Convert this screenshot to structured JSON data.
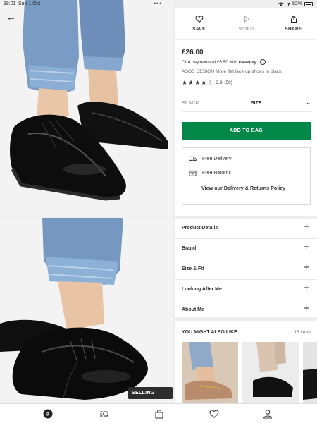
{
  "status_bar": {
    "time": "18:01",
    "date": "Sun 1 Oct",
    "battery": "82%",
    "icons": [
      "wifi-icon",
      "location-icon",
      "battery-icon"
    ]
  },
  "header": {
    "back_icon": "back-arrow-icon"
  },
  "badge": {
    "selling_fast": "SELLING FAST"
  },
  "actions": [
    {
      "label": "SAVE",
      "icon": "heart-icon"
    },
    {
      "label": "VIDEO",
      "icon": "play-icon"
    },
    {
      "label": "SHARE",
      "icon": "share-icon"
    }
  ],
  "product": {
    "price": "£26.00",
    "clearpay_text": "Or 4 payments of £6.50 with",
    "clearpay_brand": "clearpay",
    "name": "ASOS DESIGN More flat lace up shoes in black",
    "rating": "3.9",
    "reviews": "(50)",
    "stars_filled": 4
  },
  "selectors": {
    "colour": "BLACK",
    "size": "SIZE"
  },
  "add_to_bag": "ADD TO BAG",
  "delivery": {
    "free_delivery": "Free Delivery",
    "free_returns": "Free Returns",
    "policy_link": "View our Delivery & Returns Policy"
  },
  "accordion": [
    {
      "label": "Product Details"
    },
    {
      "label": "Brand"
    },
    {
      "label": "Size & Fit"
    },
    {
      "label": "Looking After Me"
    },
    {
      "label": "About Me"
    }
  ],
  "also_like": {
    "title": "YOU MIGHT ALSO LIKE",
    "count": "16 items"
  },
  "bottom_nav": [
    {
      "icon": "asos-home-icon"
    },
    {
      "icon": "search-icon"
    },
    {
      "icon": "bag-icon"
    },
    {
      "icon": "heart-icon"
    },
    {
      "icon": "account-icon"
    }
  ],
  "colors": {
    "accent_green": "#018849",
    "text": "#2d2d2d"
  }
}
